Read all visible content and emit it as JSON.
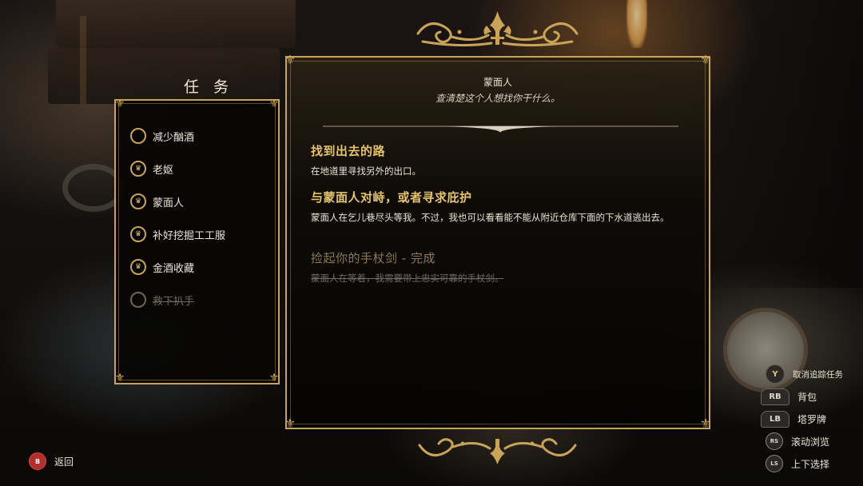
{
  "panel_title": "任 务",
  "quests": [
    {
      "label": "减少酗酒",
      "icon": "empty-circle-icon",
      "status": "active"
    },
    {
      "label": "老妪",
      "icon": "crown-medallion-icon",
      "status": "active"
    },
    {
      "label": "蒙面人",
      "icon": "crown-medallion-icon",
      "status": "active"
    },
    {
      "label": "补好挖掘工工服",
      "icon": "crown-medallion-icon",
      "status": "active"
    },
    {
      "label": "金酒收藏",
      "icon": "crown-medallion-icon",
      "status": "active"
    },
    {
      "label": "救下扒手",
      "icon": "empty-circle-icon",
      "status": "completed"
    }
  ],
  "detail": {
    "quest_name": "蒙面人",
    "quest_description": "查清楚这个人想找你干什么。",
    "objectives": [
      {
        "title": "找到出去的路",
        "text": "在地道里寻找另外的出口。",
        "complete": false
      },
      {
        "title": "与蒙面人对峙，或者寻求庇护",
        "text": "蒙面人在乞儿巷尽头等我。不过，我也可以看看能不能从附近仓库下面的下水道逃出去。",
        "complete": false
      },
      {
        "title": "捡起你的手杖剑 - 完成",
        "text": "蒙面人在等着，我需要带上忠实可靠的手杖剑。",
        "complete": true
      }
    ]
  },
  "prompts": {
    "back": {
      "button": "B",
      "label": "返回"
    },
    "untrack": {
      "button": "Y",
      "label": "取消追踪任务"
    },
    "backpack": {
      "button": "RB",
      "label": "背包"
    },
    "tarot": {
      "button": "LB",
      "label": "塔罗牌"
    },
    "scroll": {
      "button": "RS",
      "label": "滚动浏览"
    },
    "select": {
      "button": "LS",
      "label": "上下选择"
    }
  },
  "colors": {
    "gold": "#c9a458",
    "gold_text": "#e5c46e",
    "completed_text": "#6e6a61",
    "back_button": "#b52e2e"
  }
}
